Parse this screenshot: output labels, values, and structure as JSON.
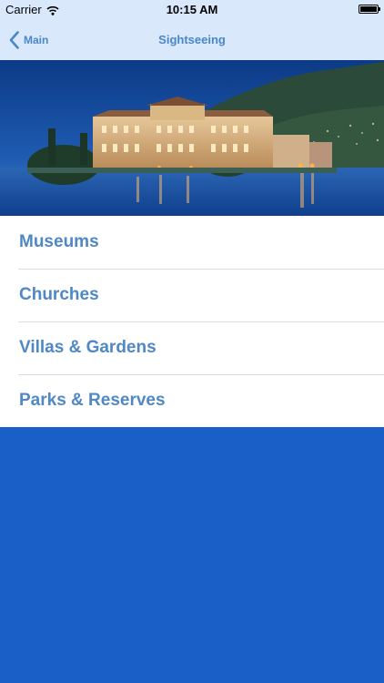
{
  "status_bar": {
    "carrier": "Carrier",
    "time": "10:15 AM",
    "wifi_icon": "wifi-icon",
    "battery_icon": "battery-icon"
  },
  "nav": {
    "back_label": "Main",
    "back_icon": "chevron-left-icon",
    "title": "Sightseeing",
    "tint_color": "#4a87c9",
    "bar_color": "#d9e8fb"
  },
  "hero": {
    "image": "lakeside-palace-photo"
  },
  "list": {
    "items": [
      {
        "label": "Museums"
      },
      {
        "label": "Churches"
      },
      {
        "label": "Villas & Gardens"
      },
      {
        "label": "Parks & Reserves"
      }
    ],
    "text_color": "#4f88c5"
  },
  "background_color": "#1a5fc8"
}
